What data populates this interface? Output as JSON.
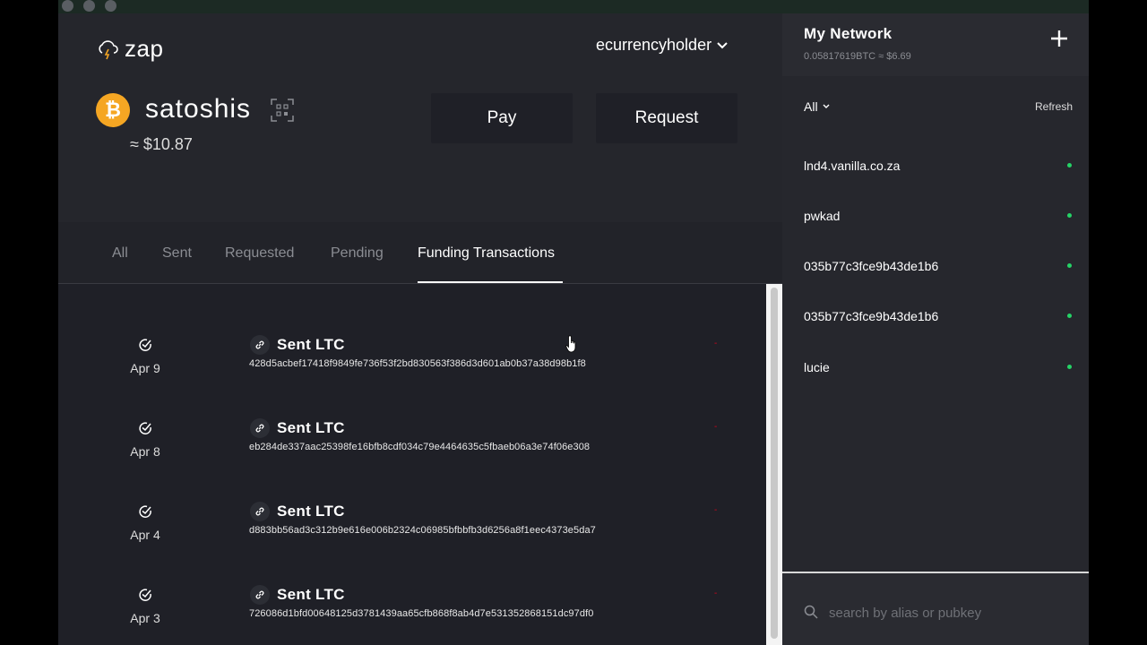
{
  "app": {
    "name": "zap"
  },
  "account": {
    "name": "ecurrencyholder"
  },
  "balance": {
    "unit": "satoshis",
    "fiat": "≈ $10.87",
    "currency_icon": "bitcoin-icon"
  },
  "actions": {
    "pay_label": "Pay",
    "request_label": "Request"
  },
  "tabs": [
    {
      "label": "All",
      "active": false
    },
    {
      "label": "Sent",
      "active": false
    },
    {
      "label": "Requested",
      "active": false
    },
    {
      "label": "Pending",
      "active": false
    },
    {
      "label": "Funding Transactions",
      "active": true
    }
  ],
  "transactions": [
    {
      "date": "Apr 9",
      "title": "Sent LTC",
      "hash": "428d5acbef17418f9849fe736f53f2bd830563f386d3d601ab0b37a38d98b1f8",
      "amount": "-"
    },
    {
      "date": "Apr 8",
      "title": "Sent LTC",
      "hash": "eb284de337aac25398fe16bfb8cdf034c79e4464635c5fbaeb06a3e74f06e308",
      "amount": "-"
    },
    {
      "date": "Apr 4",
      "title": "Sent LTC",
      "hash": "d883bb56ad3c312b9e616e006b2324c06985bfbbfb3d6256a8f1eec4373e5da7",
      "amount": "-"
    },
    {
      "date": "Apr 3",
      "title": "Sent LTC",
      "hash": "726086d1bfd00648125d3781439aa65cfb868f8ab4d7e531352868151dc97df0",
      "amount": "-"
    }
  ],
  "network": {
    "title": "My Network",
    "balance": "0.05817619BTC ≈ $6.69",
    "filter_label": "All",
    "refresh_label": "Refresh",
    "peers": [
      {
        "name": "lnd4.vanilla.co.za",
        "status": "online"
      },
      {
        "name": "pwkad",
        "status": "online"
      },
      {
        "name": "035b77c3fce9b43de1b6",
        "status": "online"
      },
      {
        "name": "035b77c3fce9b43de1b6",
        "status": "online"
      },
      {
        "name": "lucie",
        "status": "online"
      }
    ],
    "search_placeholder": "search by alias or pubkey"
  },
  "colors": {
    "accent_btc": "#f5a623",
    "online": "#25d366",
    "negative": "#d0021b"
  }
}
